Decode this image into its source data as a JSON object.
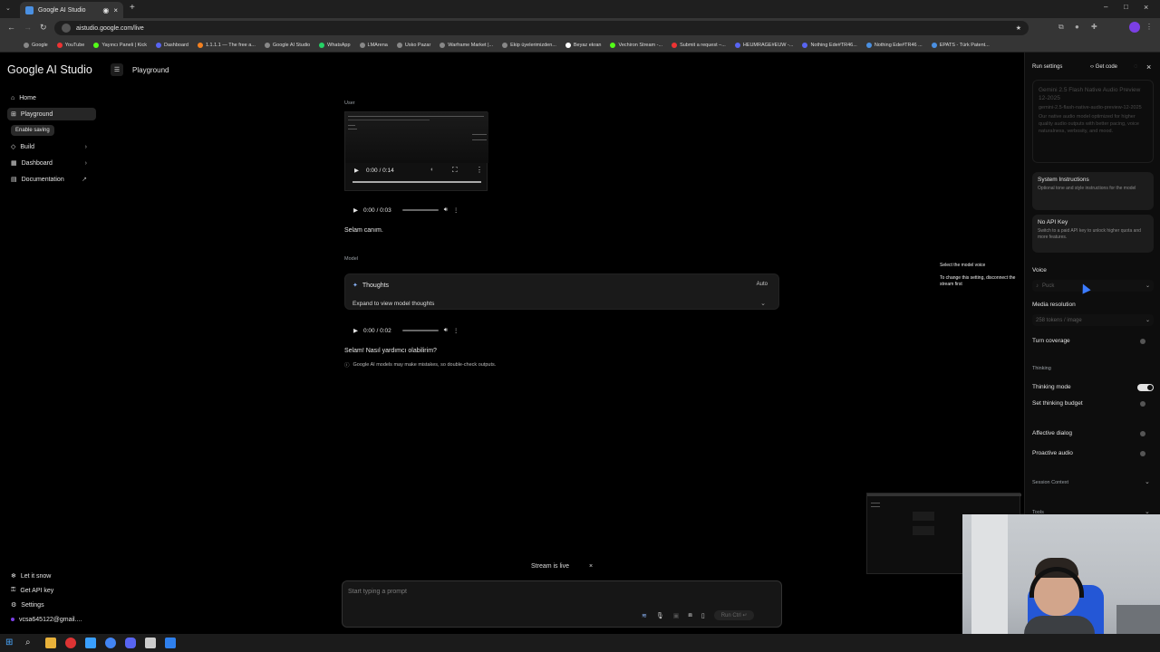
{
  "browser": {
    "tab_title": "Google AI Studio",
    "url": "aistudio.google.com/live",
    "bookmarks": [
      "Google",
      "YouTube",
      "Yayıncı Paneli | Kick",
      "Dashboard",
      "1.1.1.1 — The free a...",
      "Google AI Studio",
      "WhatsApp",
      "LMArena",
      "Usko Pazar",
      "Warframe Market |...",
      "Ekip üyelerimizden...",
      "Beyaz ekran",
      "Vechiron Stream -...",
      "Submit a request –...",
      "HEUMRAGE#EUW -...",
      "Nothing Ede#TR46...",
      "Nothing Ede#TR46 ...",
      "EPATS - Türk Patent..."
    ]
  },
  "sidebar": {
    "logo": "Google AI Studio",
    "items": [
      {
        "label": "Home"
      },
      {
        "label": "Playground"
      },
      {
        "label": "Build"
      },
      {
        "label": "Dashboard"
      },
      {
        "label": "Documentation"
      }
    ],
    "enable_saving": "Enable saving",
    "bottom": [
      {
        "label": "Let it snow"
      },
      {
        "label": "Get API key"
      },
      {
        "label": "Settings"
      },
      {
        "label": "vcsa645122@gmail...."
      }
    ]
  },
  "header": {
    "title": "Playground"
  },
  "chat": {
    "user_role": "User",
    "video_time": "0:00 / 0:14",
    "user_audio_time": "0:00 / 0:03",
    "user_text": "Selam canım.",
    "model_role": "Model",
    "thoughts_title": "Thoughts",
    "thoughts_mode": "Auto",
    "thoughts_expand": "Expand to view model thoughts",
    "model_audio_time": "0:00 / 0:02",
    "model_text": "Selam! Nasıl yardımcı olabilirim?",
    "disclaimer": "Google AI models may make mistakes, so double-check outputs.",
    "stream_status": "Stream is live",
    "prompt_placeholder": "Start typing a prompt",
    "run_label": "Run Ctrl ↵"
  },
  "tooltip": {
    "title": "Select the model voice",
    "body": "To change this setting, disconnect the stream first"
  },
  "run_settings": {
    "title": "Run settings",
    "get_code": "Get code",
    "model_name": "Gemini 2.5 Flash Native Audio Preview 12-2025",
    "model_id": "gemini-2.5-flash-native-audio-preview-12-2025",
    "model_desc": "Our native audio model optimized for higher quality audio outputs with better pacing, voice naturalness, verbosity, and mood.",
    "system_instructions_title": "System Instructions",
    "system_instructions_desc": "Optional tone and style instructions for the model",
    "api_key_title": "No API Key",
    "api_key_desc": "Switch to a paid API key to unlock higher quota and more features.",
    "voice_label": "Voice",
    "voice_value": "Puck",
    "media_resolution_label": "Media resolution",
    "media_resolution_value": "258 tokens / image",
    "turn_coverage": "Turn coverage",
    "thinking_section": "Thinking",
    "thinking_mode": "Thinking mode",
    "thinking_budget": "Set thinking budget",
    "affective_dialog": "Affective dialog",
    "proactive_audio": "Proactive audio",
    "session_context": "Session Context",
    "tools": "Tools",
    "toggles": {
      "turn_coverage": false,
      "thinking_mode": true,
      "thinking_budget": false,
      "affective_dialog": false,
      "proactive_audio": false
    }
  },
  "colors": {
    "accent": "#3b7bff",
    "panel": "#1c1c1c",
    "background": "#000000"
  }
}
